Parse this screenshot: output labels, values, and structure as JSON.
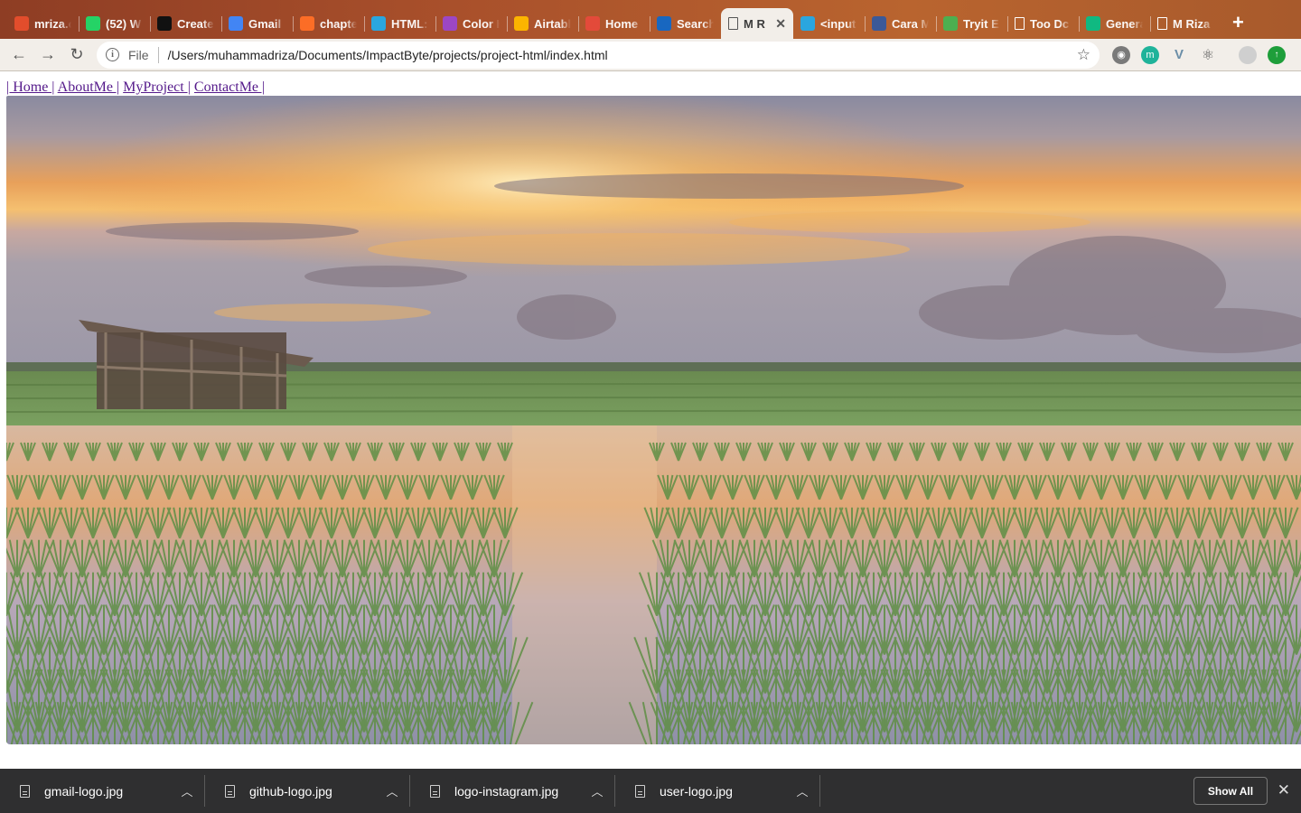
{
  "browser": {
    "tabs": [
      {
        "label": "mriza.c",
        "icon": "figma-icon",
        "color": "#e24d2c"
      },
      {
        "label": "(52) W",
        "icon": "whatsapp-icon",
        "color": "#25d366"
      },
      {
        "label": "Create",
        "icon": "github-icon",
        "color": "#111111"
      },
      {
        "label": "Gmail",
        "icon": "google-icon",
        "color": "#4285f4"
      },
      {
        "label": "chapte",
        "icon": "gitlab-icon",
        "color": "#fc6d26"
      },
      {
        "label": "HTML:",
        "icon": "codepen-icon",
        "color": "#2aa6df"
      },
      {
        "label": "Color H",
        "icon": "color-wheel-icon",
        "color": "#9c47c4"
      },
      {
        "label": "Airtabl",
        "icon": "airtable-icon",
        "color": "#fcb400"
      },
      {
        "label": "Home",
        "icon": "home-icon",
        "color": "#e34a3a"
      },
      {
        "label": "Search",
        "icon": "vuetify-icon",
        "color": "#1867c0"
      },
      {
        "label": "M R",
        "icon": "file-icon",
        "color": "#ffffff",
        "active": true
      },
      {
        "label": "<input",
        "icon": "codepen-icon",
        "color": "#2aa6df"
      },
      {
        "label": "Cara M",
        "icon": "tutorial-icon",
        "color": "#3b5998"
      },
      {
        "label": "Tryit E",
        "icon": "w3schools-icon",
        "color": "#4caf50"
      },
      {
        "label": "Too Dc",
        "icon": "file-icon",
        "color": "#ffffff"
      },
      {
        "label": "Genera",
        "icon": "diamond-icon",
        "color": "#10b981"
      },
      {
        "label": "M Riza",
        "icon": "file-icon",
        "color": "#ffffff"
      }
    ],
    "new_tab": "+",
    "address": {
      "scheme": "File",
      "url": "/Users/muhammadriza/Documents/ImpactByte/projects/project-html/index.html"
    }
  },
  "page": {
    "nav": [
      "| Home |",
      "AboutMe |",
      "MyProject |",
      "ContactMe |"
    ]
  },
  "downloads": {
    "items": [
      "gmail-logo.jpg",
      "github-logo.jpg",
      "logo-instagram.jpg",
      "user-logo.jpg"
    ],
    "show_all": "Show All"
  }
}
